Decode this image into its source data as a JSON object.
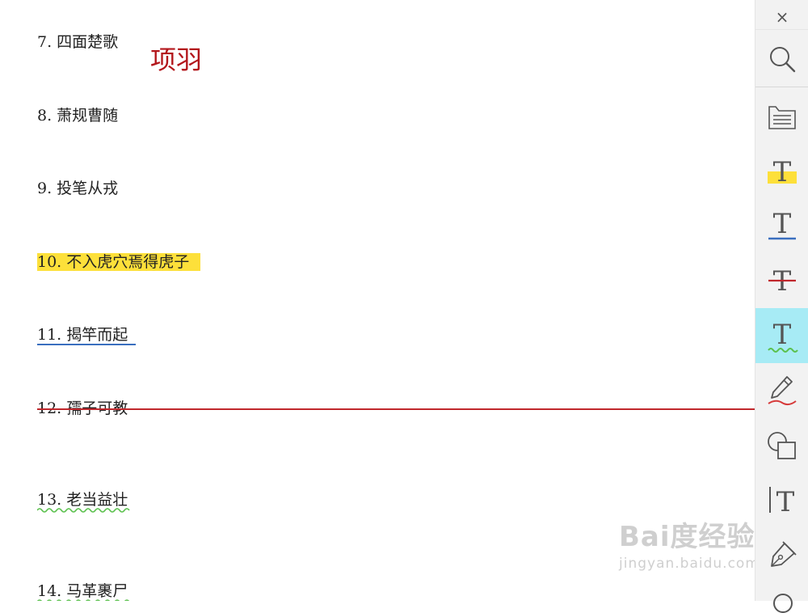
{
  "document": {
    "items": [
      {
        "text": "7. 四面楚歌",
        "style": "plain"
      },
      {
        "text": "8. 萧规曹随",
        "style": "plain"
      },
      {
        "text": "9. 投笔从戎",
        "style": "plain"
      },
      {
        "text": "10. 不入虎穴焉得虎子",
        "style": "highlight"
      },
      {
        "text": "11. 揭竿而起",
        "style": "underline"
      },
      {
        "text": "12. 孺子可教",
        "style": "strikethrough"
      },
      {
        "text": "13. 老当益壮",
        "style": "squiggle"
      },
      {
        "text": "14. 马革裹尸",
        "style": "squiggle"
      }
    ],
    "annotation": "项羽"
  },
  "watermark": {
    "brand": "Bai度经验",
    "url": "jingyan.baidu.com"
  },
  "toolbar": {
    "close_label": "×",
    "tools": [
      {
        "name": "search",
        "icon": "search-icon"
      },
      {
        "name": "comment",
        "icon": "comment-note-icon"
      },
      {
        "name": "highlight",
        "icon": "text-highlight-icon"
      },
      {
        "name": "underline",
        "icon": "text-underline-icon"
      },
      {
        "name": "strikethrough",
        "icon": "text-strikethrough-icon"
      },
      {
        "name": "squiggly",
        "icon": "text-squiggly-icon",
        "active": true
      },
      {
        "name": "pen",
        "icon": "pen-draw-icon"
      },
      {
        "name": "shapes",
        "icon": "shapes-icon"
      },
      {
        "name": "text-box",
        "icon": "text-box-icon"
      },
      {
        "name": "signature",
        "icon": "fountain-pen-icon"
      }
    ]
  },
  "colors": {
    "highlight": "#fde03a",
    "underline": "#3a6fbf",
    "strike": "#c0282d",
    "squiggle": "#5cc14f",
    "annotation": "#b3161b",
    "active_tool": "#a7ebf5"
  }
}
